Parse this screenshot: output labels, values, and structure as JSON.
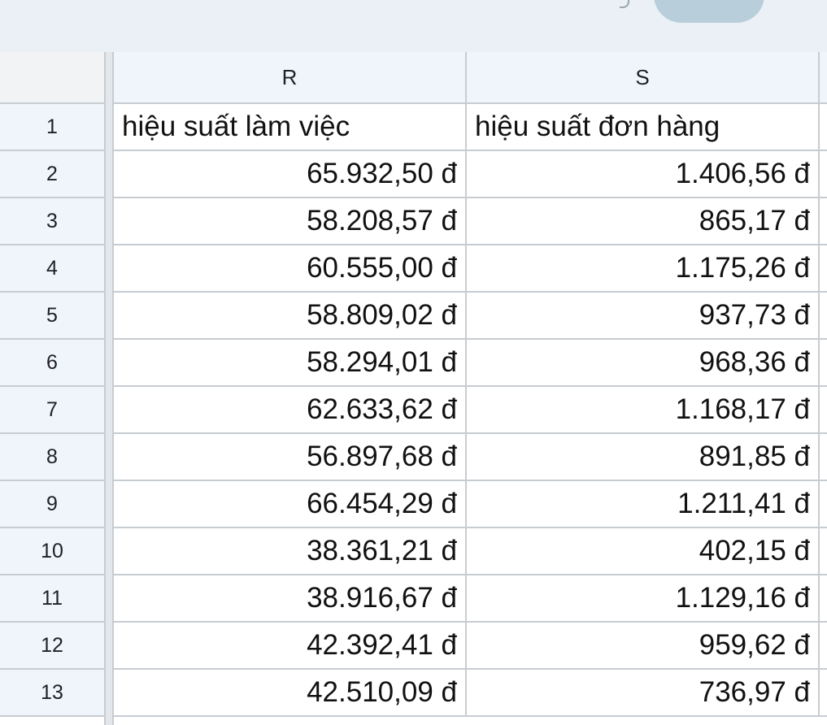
{
  "columns": {
    "R": "R",
    "S": "S"
  },
  "rows": [
    {
      "num": "1",
      "r": "hiệu suất làm việc",
      "s": "hiệu suất đơn hàng"
    },
    {
      "num": "2",
      "r": "65.932,50 đ",
      "s": "1.406,56 đ"
    },
    {
      "num": "3",
      "r": "58.208,57 đ",
      "s": "865,17 đ"
    },
    {
      "num": "4",
      "r": "60.555,00 đ",
      "s": "1.175,26 đ"
    },
    {
      "num": "5",
      "r": "58.809,02 đ",
      "s": "937,73 đ"
    },
    {
      "num": "6",
      "r": "58.294,01 đ",
      "s": "968,36 đ"
    },
    {
      "num": "7",
      "r": "62.633,62 đ",
      "s": "1.168,17 đ"
    },
    {
      "num": "8",
      "r": "56.897,68 đ",
      "s": "891,85 đ"
    },
    {
      "num": "9",
      "r": "66.454,29 đ",
      "s": "1.211,41 đ"
    },
    {
      "num": "10",
      "r": "38.361,21 đ",
      "s": "402,15 đ"
    },
    {
      "num": "11",
      "r": "38.916,67 đ",
      "s": "1.129,16 đ"
    },
    {
      "num": "12",
      "r": "42.392,41 đ",
      "s": "959,62 đ"
    },
    {
      "num": "13",
      "r": "42.510,09 đ",
      "s": "736,97 đ"
    }
  ]
}
